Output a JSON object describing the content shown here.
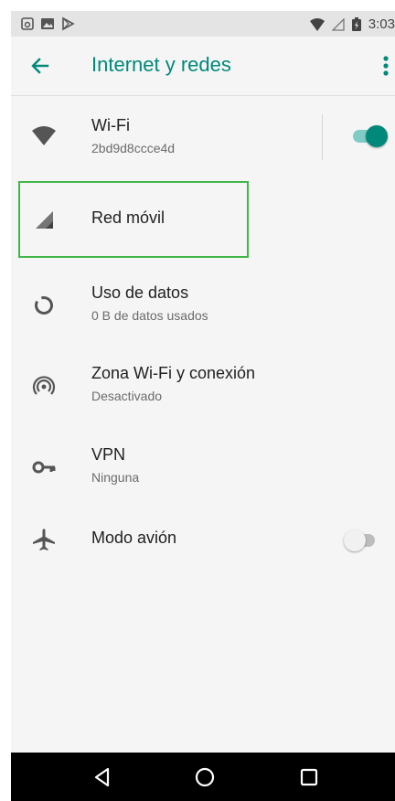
{
  "status_bar": {
    "time": "3:03",
    "left_icons": [
      "screenshot-icon",
      "image-icon",
      "play-store-icon"
    ],
    "right_icons": [
      "wifi-signal-icon",
      "cell-signal-icon",
      "battery-icon"
    ]
  },
  "app_bar": {
    "title": "Internet y redes",
    "back_icon": "arrow-back-icon",
    "menu_icon": "more-vert-icon"
  },
  "colors": {
    "accent": "#00897b",
    "toggle_on_track": "#80cbc4",
    "toggle_off_track": "#bdbdbd",
    "highlight_box": "#43b649"
  },
  "items": [
    {
      "icon": "wifi-icon",
      "title": "Wi-Fi",
      "subtitle": "2bd9d8ccce4d",
      "toggle": true
    },
    {
      "icon": "mobile-signal-icon",
      "title": "Red móvil",
      "subtitle": ""
    },
    {
      "icon": "data-usage-icon",
      "title": "Uso de datos",
      "subtitle": "0 B de datos usados"
    },
    {
      "icon": "hotspot-icon",
      "title": "Zona Wi-Fi y conexión",
      "subtitle": "Desactivado"
    },
    {
      "icon": "vpn-key-icon",
      "title": "VPN",
      "subtitle": "Ninguna"
    },
    {
      "icon": "airplane-icon",
      "title": "Modo avión",
      "subtitle": "",
      "toggle": false
    }
  ],
  "nav_bar": {
    "icons": [
      "back-triangle-icon",
      "home-circle-icon",
      "recents-square-icon"
    ]
  }
}
